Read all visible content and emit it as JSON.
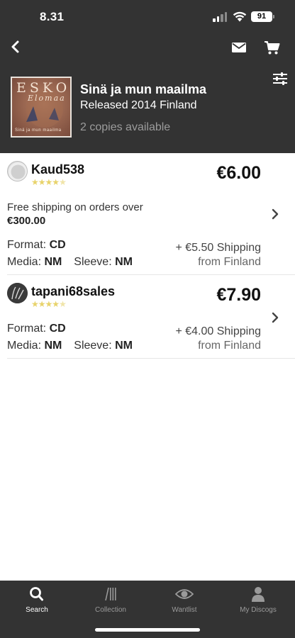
{
  "status": {
    "time": "8.31",
    "battery": "91"
  },
  "release": {
    "title": "Sinä ja mun maailma",
    "subtitle": "Released 2014 Finland",
    "copies": "2 copies available",
    "cover": {
      "artist": "ESKO",
      "artist_sub": "Elomaa",
      "bottom_text": "Sinä ja mun maailma"
    }
  },
  "listings": [
    {
      "seller": "Kaud538",
      "rating": 4.5,
      "stars": "★★★★★",
      "price": "€6.00",
      "free_shipping_line1": "Free shipping on orders over",
      "free_shipping_line2": "€300.00",
      "format_label": "Format:",
      "format_value": "CD",
      "media_label": "Media:",
      "media_value": "NM",
      "sleeve_label": "Sleeve:",
      "sleeve_value": "NM",
      "shipping": "+ €5.50 Shipping",
      "ships_from": "from Finland"
    },
    {
      "seller": "tapani68sales",
      "rating": 4.5,
      "stars": "★★★★★",
      "price": "€7.90",
      "format_label": "Format:",
      "format_value": "CD",
      "media_label": "Media:",
      "media_value": "NM",
      "sleeve_label": "Sleeve:",
      "sleeve_value": "NM",
      "shipping": "+ €4.00 Shipping",
      "ships_from": "from Finland"
    }
  ],
  "tabs": [
    {
      "label": "Search",
      "icon": "search-icon",
      "active": true
    },
    {
      "label": "Collection",
      "icon": "collection-icon",
      "active": false
    },
    {
      "label": "Wantlist",
      "icon": "eye-icon",
      "active": false
    },
    {
      "label": "My Discogs",
      "icon": "profile-icon",
      "active": false
    }
  ],
  "colors": {
    "header_bg": "#333333",
    "star": "#e8d36b",
    "tab_inactive": "#9a9a9a"
  }
}
